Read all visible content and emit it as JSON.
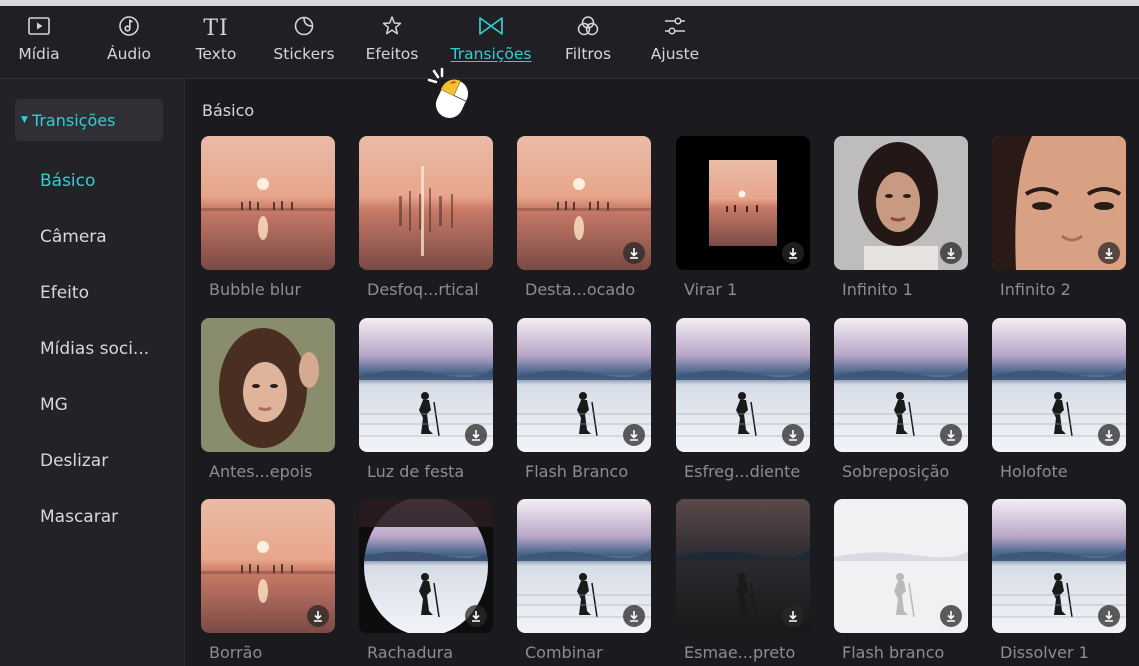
{
  "toolbar": {
    "tabs": [
      {
        "label": "Mídia",
        "icon": "media-icon"
      },
      {
        "label": "Áudio",
        "icon": "audio-icon"
      },
      {
        "label": "Texto",
        "icon": "text-icon",
        "glyph": "TI"
      },
      {
        "label": "Stickers",
        "icon": "sticker-icon"
      },
      {
        "label": "Efeitos",
        "icon": "effects-star-icon"
      },
      {
        "label": "Transições",
        "icon": "transition-bowtie-icon",
        "active": true
      },
      {
        "label": "Filtros",
        "icon": "filters-icon"
      },
      {
        "label": "Ajuste",
        "icon": "adjust-sliders-icon"
      }
    ],
    "accent_color": "#2fd0cf"
  },
  "sidebar": {
    "header": "Transições",
    "items": [
      {
        "label": "Básico",
        "selected": true
      },
      {
        "label": "Câmera"
      },
      {
        "label": "Efeito"
      },
      {
        "label": "Mídias soci..."
      },
      {
        "label": "MG"
      },
      {
        "label": "Deslizar"
      },
      {
        "label": "Mascarar"
      }
    ]
  },
  "main": {
    "section_title": "Básico",
    "tiles": [
      {
        "name": "Bubble blur",
        "download": false
      },
      {
        "name": "Desfoq...rtical",
        "download": false
      },
      {
        "name": "Desta...ocado",
        "download": true
      },
      {
        "name": "Virar 1",
        "download": true
      },
      {
        "name": "Infinito 1",
        "download": true
      },
      {
        "name": "Infinito 2",
        "download": true
      },
      {
        "name": "Antes...epois",
        "download": false
      },
      {
        "name": "Luz de festa",
        "download": true
      },
      {
        "name": "Flash Branco",
        "download": true
      },
      {
        "name": "Esfreg...diente",
        "download": true
      },
      {
        "name": "Sobreposição",
        "download": true
      },
      {
        "name": "Holofote",
        "download": true
      },
      {
        "name": "Borrão",
        "download": true
      },
      {
        "name": "Rachadura",
        "download": true
      },
      {
        "name": "Combinar",
        "download": true
      },
      {
        "name": "Esmae...preto",
        "download": true
      },
      {
        "name": "Flash branco",
        "download": true
      },
      {
        "name": "Dissolver 1",
        "download": true
      }
    ]
  },
  "cursor": {
    "icon": "mouse-click-icon"
  }
}
